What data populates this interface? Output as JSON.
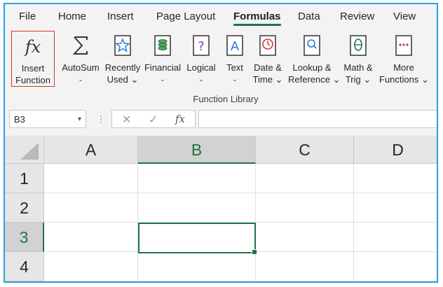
{
  "tabs": [
    "File",
    "Home",
    "Insert",
    "Page Layout",
    "Formulas",
    "Data",
    "Review",
    "View"
  ],
  "active_tab": "Formulas",
  "ribbon": {
    "insert_function": [
      "Insert",
      "Function"
    ],
    "autosum": [
      "AutoSum",
      "⌄"
    ],
    "recently_used": [
      "Recently",
      "Used ⌄"
    ],
    "financial": [
      "Financial",
      "⌄"
    ],
    "logical": [
      "Logical",
      "⌄"
    ],
    "text": [
      "Text",
      "⌄"
    ],
    "date_time": [
      "Date &",
      "Time ⌄"
    ],
    "lookup": [
      "Lookup &",
      "Reference ⌄"
    ],
    "math_trig": [
      "Math &",
      "Trig ⌄"
    ],
    "more_functions": [
      "More",
      "Functions ⌄"
    ],
    "group_label": "Function Library"
  },
  "formula_bar": {
    "name_box": "B3",
    "name_box_dropdown": "▾",
    "separator": "⋮",
    "cancel": "✕",
    "enter": "✓",
    "fx": "fx",
    "formula": ""
  },
  "columns": [
    "A",
    "B",
    "C",
    "D"
  ],
  "rows": [
    "1",
    "2",
    "3",
    "4"
  ],
  "selected_cell": "B3",
  "colors": {
    "accent": "#217346",
    "frame": "#29a3d6",
    "highlight_border": "#d9342b"
  }
}
